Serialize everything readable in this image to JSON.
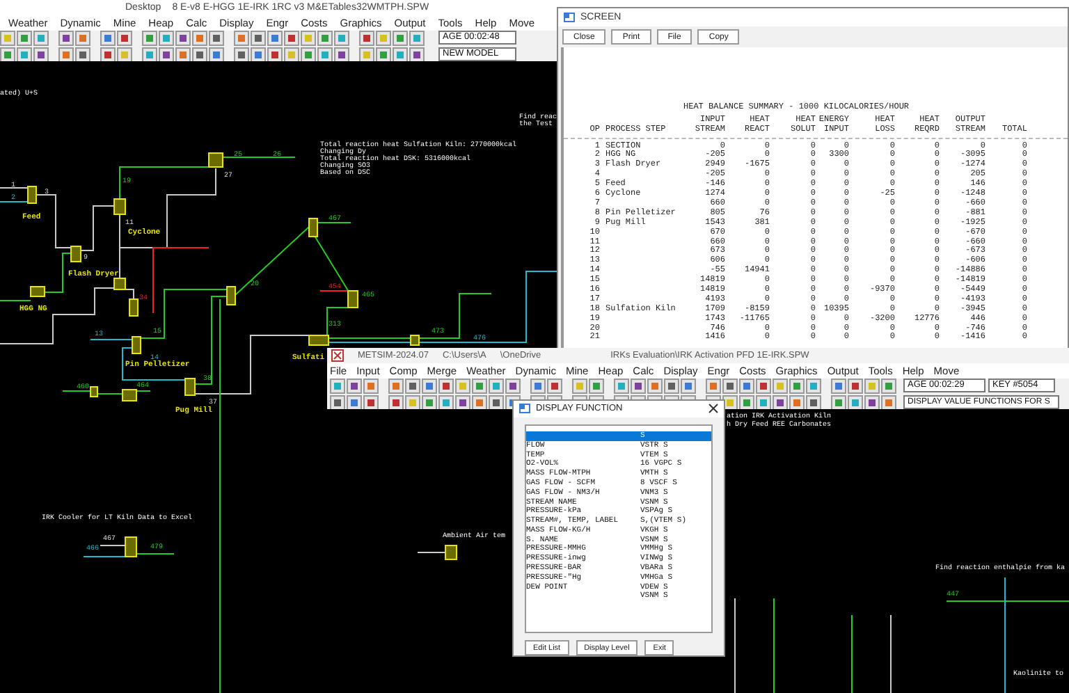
{
  "main_window": {
    "title_path": "Desktop",
    "title": "8 E-v8 E-HGG 1E-IRK 1RC v3 M&ETables32WMTPH.SPW",
    "menu": [
      "Weather",
      "Dynamic",
      "Mine",
      "Heap",
      "Calc",
      "Display",
      "Engr",
      "Costs",
      "Graphics",
      "Output",
      "Tools",
      "Help",
      "Move"
    ],
    "age": "AGE 00:02:48",
    "status": "NEW MODEL",
    "canvas_texts": [
      {
        "text": "ated) U+S",
        "kind": "note"
      },
      {
        "text": "Total reaction heat Sulfation Kiln: 2770000kcal",
        "kind": "note"
      },
      {
        "text": "Changing Dy",
        "kind": "note"
      },
      {
        "text": "Total reaction heat DSK: 5316000kcal",
        "kind": "note"
      },
      {
        "text": "Changing SO3",
        "kind": "note"
      },
      {
        "text": "Based on DSC",
        "kind": "note"
      },
      {
        "text": "Find reac",
        "kind": "note"
      },
      {
        "text": "the Test",
        "kind": "note"
      },
      {
        "text": "Feed",
        "kind": "unit"
      },
      {
        "text": "Cyclone",
        "kind": "unit"
      },
      {
        "text": "Flash Dryer",
        "kind": "unit"
      },
      {
        "text": "HGG NG",
        "kind": "unit"
      },
      {
        "text": "Pin Pelletizer",
        "kind": "unit"
      },
      {
        "text": "Pug Mill",
        "kind": "unit"
      },
      {
        "text": "Sulfati",
        "kind": "unit"
      },
      {
        "text": "1",
        "kind": "white"
      },
      {
        "text": "2",
        "kind": "cyan"
      },
      {
        "text": "3",
        "kind": "white"
      },
      {
        "text": "19",
        "kind": "green"
      },
      {
        "text": "25",
        "kind": "green"
      },
      {
        "text": "26",
        "kind": "green"
      },
      {
        "text": "27",
        "kind": "white"
      },
      {
        "text": "11",
        "kind": "white"
      },
      {
        "text": "9",
        "kind": "white"
      },
      {
        "text": "467",
        "kind": "green"
      },
      {
        "text": "20",
        "kind": "green"
      },
      {
        "text": "34",
        "kind": "red"
      },
      {
        "text": "454",
        "kind": "red"
      },
      {
        "text": "465",
        "kind": "green"
      },
      {
        "text": "313",
        "kind": "green"
      },
      {
        "text": "15",
        "kind": "green"
      },
      {
        "text": "13",
        "kind": "cyan"
      },
      {
        "text": "14",
        "kind": "cyan"
      },
      {
        "text": "38",
        "kind": "green"
      },
      {
        "text": "37",
        "kind": "white"
      },
      {
        "text": "460",
        "kind": "green"
      },
      {
        "text": "464",
        "kind": "green"
      },
      {
        "text": "473",
        "kind": "green"
      },
      {
        "text": "476",
        "kind": "cyan"
      },
      {
        "text": "IRK Cooler for LT Kiln Data to Excel",
        "kind": "note"
      },
      {
        "text": "467",
        "kind": "white"
      },
      {
        "text": "466",
        "kind": "cyan"
      },
      {
        "text": "479",
        "kind": "green"
      }
    ]
  },
  "screen_window": {
    "title": "SCREEN",
    "buttons": [
      "Close",
      "Print",
      "File",
      "Copy"
    ],
    "heading": "HEAT BALANCE SUMMARY - 1000 KILOCALORIES/HOUR",
    "columns": [
      {
        "lines": [
          "OP"
        ]
      },
      {
        "lines": [
          "PROCESS STEP"
        ]
      },
      {
        "lines": [
          "INPUT",
          "STREAM"
        ]
      },
      {
        "lines": [
          "HEAT",
          "REACT"
        ]
      },
      {
        "lines": [
          "HEAT",
          "SOLUT"
        ]
      },
      {
        "lines": [
          "ENERGY",
          "INPUT"
        ]
      },
      {
        "lines": [
          "HEAT",
          "LOSS"
        ]
      },
      {
        "lines": [
          "HEAT",
          "REQRD"
        ]
      },
      {
        "lines": [
          "OUTPUT",
          "STREAM"
        ]
      },
      {
        "lines": [
          "TOTAL"
        ]
      }
    ],
    "rows": [
      {
        "op": "1",
        "step": "SECTION",
        "values": [
          "0",
          "0",
          "0",
          "0",
          "0",
          "0",
          "0",
          "0"
        ]
      },
      {
        "op": "2",
        "step": "HGG NG",
        "values": [
          "-205",
          "0",
          "0",
          "3300",
          "0",
          "0",
          "-3095",
          "0"
        ]
      },
      {
        "op": "3",
        "step": "Flash Dryer",
        "values": [
          "2949",
          "-1675",
          "0",
          "0",
          "0",
          "0",
          "-1274",
          "0"
        ]
      },
      {
        "op": "4",
        "values": [
          "-205",
          "0",
          "0",
          "0",
          "0",
          "0",
          "205",
          "0"
        ]
      },
      {
        "op": "5",
        "step": "Feed",
        "values": [
          "-146",
          "0",
          "0",
          "0",
          "0",
          "0",
          "146",
          "0"
        ]
      },
      {
        "op": "6",
        "step": "Cyclone",
        "values": [
          "1274",
          "0",
          "0",
          "0",
          "-25",
          "0",
          "-1248",
          "0"
        ]
      },
      {
        "op": "7",
        "values": [
          "660",
          "0",
          "0",
          "0",
          "0",
          "0",
          "-660",
          "0"
        ]
      },
      {
        "op": "8",
        "step": "Pin Pelletizer",
        "values": [
          "805",
          "76",
          "0",
          "0",
          "0",
          "0",
          "-881",
          "0"
        ]
      },
      {
        "op": "9",
        "step": "Pug Mill",
        "values": [
          "1543",
          "381",
          "0",
          "0",
          "0",
          "0",
          "-1925",
          "0"
        ]
      },
      {
        "op": "10",
        "values": [
          "670",
          "0",
          "0",
          "0",
          "0",
          "0",
          "-670",
          "0"
        ]
      },
      {
        "op": "11",
        "values": [
          "660",
          "0",
          "0",
          "0",
          "0",
          "0",
          "-660",
          "0"
        ]
      },
      {
        "op": "12",
        "values": [
          "673",
          "0",
          "0",
          "0",
          "0",
          "0",
          "-673",
          "0"
        ]
      },
      {
        "op": "13",
        "values": [
          "606",
          "0",
          "0",
          "0",
          "0",
          "0",
          "-606",
          "0"
        ]
      },
      {
        "op": "14",
        "values": [
          "-55",
          "14941",
          "0",
          "0",
          "0",
          "0",
          "-14886",
          "0"
        ]
      },
      {
        "op": "15",
        "values": [
          "14819",
          "0",
          "0",
          "0",
          "0",
          "0",
          "-14819",
          "0"
        ]
      },
      {
        "op": "16",
        "values": [
          "14819",
          "0",
          "0",
          "0",
          "-9370",
          "0",
          "-5449",
          "0"
        ]
      },
      {
        "op": "17",
        "values": [
          "4193",
          "0",
          "0",
          "0",
          "0",
          "0",
          "-4193",
          "0"
        ]
      },
      {
        "op": "18",
        "step": "Sulfation Kiln",
        "values": [
          "1709",
          "-8159",
          "0",
          "10395",
          "0",
          "0",
          "-3945",
          "0"
        ]
      },
      {
        "op": "19",
        "values": [
          "1743",
          "-11765",
          "0",
          "0",
          "-3200",
          "12776",
          "446",
          "0"
        ]
      },
      {
        "op": "20",
        "values": [
          "746",
          "0",
          "0",
          "0",
          "0",
          "0",
          "-746",
          "0"
        ]
      },
      {
        "op": "21",
        "values": [
          "1416",
          "0",
          "0",
          "0",
          "0",
          "0",
          "-1416",
          "0"
        ]
      }
    ]
  },
  "front_window": {
    "app": "METSIM-2024.07",
    "path": "C:\\Users\\A",
    "folder": "\\OneDrive",
    "title": "IRKs Evaluation\\IRK Activation PFD 1E-IRK.SPW",
    "menu": [
      "File",
      "Input",
      "Comp",
      "Merge",
      "Weather",
      "Dynamic",
      "Mine",
      "Heap",
      "Calc",
      "Display",
      "Engr",
      "Costs",
      "Graphics",
      "Output",
      "Tools",
      "Help",
      "Move"
    ],
    "age": "AGE 00:02:29",
    "key": "KEY #5054",
    "hint": "DISPLAY VALUE FUNCTIONS FOR S",
    "canvas_texts": [
      {
        "text": "ation IRK Activation Kiln",
        "kind": "note"
      },
      {
        "text": "h Dry Feed REE Carbonates",
        "kind": "note"
      },
      {
        "text": "Ambient Air tem",
        "kind": "note"
      },
      {
        "text": "Find reaction enthalpie from ka",
        "kind": "note"
      },
      {
        "text": "447",
        "kind": "green"
      },
      {
        "text": "Kaolinite to",
        "kind": "note"
      }
    ]
  },
  "dialog": {
    "title": "DISPLAY FUNCTION",
    "items": [
      {
        "code": "S",
        "selected": true
      },
      {
        "name": "FLOW",
        "code": "VSTR S",
        "selected": false
      },
      {
        "name": "TEMP",
        "code": "VTEM S",
        "selected": false
      },
      {
        "name": "O2-VOL%",
        "code": "16 VGPC S",
        "selected": false
      },
      {
        "name": "MASS FLOW-MTPH",
        "code": "VMTH S",
        "selected": false
      },
      {
        "name": "GAS FLOW - SCFM",
        "code": "8 VSCF S",
        "selected": false
      },
      {
        "name": "GAS FLOW - NM3/H",
        "code": "VNM3 S",
        "selected": false
      },
      {
        "name": "STREAM NAME",
        "code": "VSNM S",
        "selected": false
      },
      {
        "name": "PRESSURE-kPa",
        "code": "VSPAg S",
        "selected": false
      },
      {
        "name": "STREAM#, TEMP, LABEL",
        "code": "S,(VTEM S)",
        "selected": false
      },
      {
        "name": "MASS FLOW-KG/H",
        "code": "VKGH S",
        "selected": false
      },
      {
        "name": "S. NAME",
        "code": "VSNM S",
        "selected": false
      },
      {
        "name": "PRESSURE-MMHG",
        "code": "VMMHg S",
        "selected": false
      },
      {
        "name": "PRESSURE-inwg",
        "code": "VINWg S",
        "selected": false
      },
      {
        "name": "PRESSURE-BAR",
        "code": "VBARa S",
        "selected": false
      },
      {
        "name": "PRESSURE-\"Hg",
        "code": "VMHGa S",
        "selected": false
      },
      {
        "name": "DEW POINT",
        "code": "VDEW S",
        "selected": false
      },
      {
        "code": "VSNM S",
        "selected": false
      }
    ],
    "buttons": [
      "Edit List",
      "Display Level",
      "Exit"
    ]
  }
}
